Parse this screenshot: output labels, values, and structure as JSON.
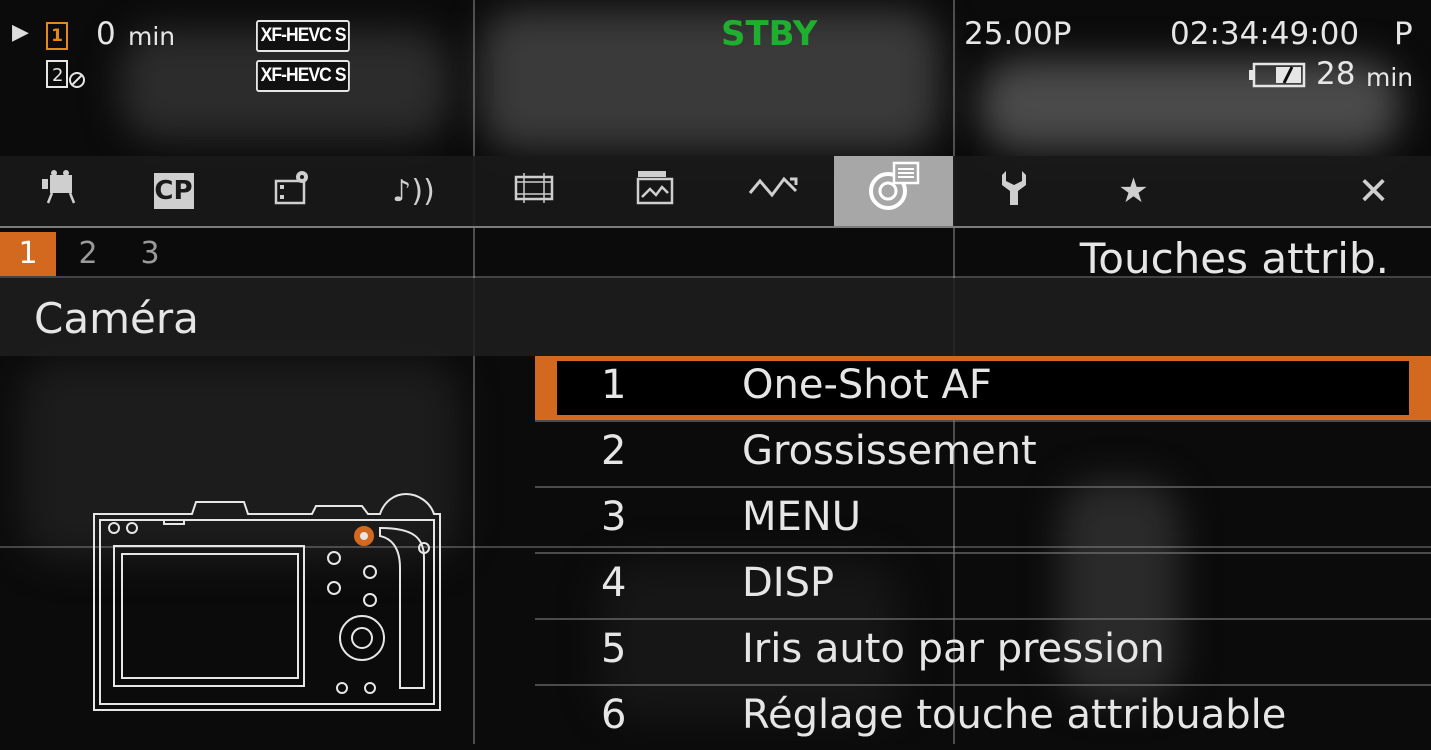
{
  "status": {
    "play_indicator": "▶",
    "slot1_label": "1",
    "slot2_label": "2",
    "record_time_value": "0",
    "record_time_unit": "min",
    "codec_1": "XF-HEVC S",
    "codec_2": "XF-HEVC S",
    "mode": "STBY",
    "mode_color": "#1fae2e",
    "frame_rate": "25.00P",
    "timecode": "02:34:49:00",
    "timecode_suffix": "P",
    "battery_value": "28",
    "battery_unit": "min"
  },
  "tabs": [
    {
      "name": "camera-setup-icon",
      "active": false
    },
    {
      "name": "custom-picture-icon",
      "active": false,
      "label": "CP"
    },
    {
      "name": "recording-setup-icon",
      "active": false
    },
    {
      "name": "audio-setup-icon",
      "active": false
    },
    {
      "name": "monitoring-setup-icon",
      "active": false
    },
    {
      "name": "recording-media-icon",
      "active": false
    },
    {
      "name": "network-icon",
      "active": false
    },
    {
      "name": "assignable-buttons-icon",
      "active": true
    },
    {
      "name": "system-setup-icon",
      "active": false
    },
    {
      "name": "my-menu-icon",
      "active": false
    },
    {
      "name": "close-icon",
      "active": false
    }
  ],
  "pages": [
    "1",
    "2",
    "3"
  ],
  "menu_title": "Touches attrib.",
  "section_title": "Caméra",
  "items": [
    {
      "num": "1",
      "label": "One-Shot AF",
      "selected": true
    },
    {
      "num": "2",
      "label": "Grossissement",
      "selected": false
    },
    {
      "num": "3",
      "label": "MENU",
      "selected": false
    },
    {
      "num": "4",
      "label": "DISP",
      "selected": false
    },
    {
      "num": "5",
      "label": "Iris auto par pression",
      "selected": false
    },
    {
      "num": "6",
      "label": "Réglage touche attribuable",
      "selected": false
    }
  ],
  "colors": {
    "accent": "#d2691e",
    "slot": "#e38a1c",
    "active_tab": "#a7a7a7"
  }
}
